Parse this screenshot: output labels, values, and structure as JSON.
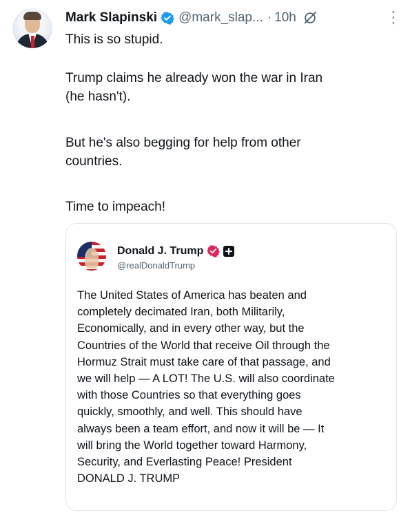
{
  "post": {
    "author_name": "Mark Slapinski",
    "author_handle": "@mark_slap...",
    "separator": "·",
    "time": "10h",
    "icons": {
      "verified": "verified-badge-icon",
      "grok": "grok-icon",
      "more": "more-options-icon"
    },
    "more_glyph": "⋮",
    "paragraphs": [
      "This is so stupid.",
      "Trump claims he already won the war in Iran\n(he hasn't).",
      "But he's also begging for help from other\ncountries.",
      "Time to impeach!"
    ]
  },
  "quoted_post": {
    "author_name": "Donald J. Trump",
    "author_handle": "@realDonaldTrump",
    "icons": {
      "verified": "verified-badge-icon",
      "affiliate": "plus-badge-icon"
    },
    "text": "The United States of America has beaten and\ncompletely decimated Iran, both Militarily,\nEconomically, and in every other way, but the\nCountries of the World that receive Oil through the\nHormuz Strait must take care of that passage, and\nwe will help — A LOT! The U.S. will also coordinate\nwith those Countries so that everything goes\nquickly, smoothly, and well. This should have\nalways been a team effort, and now it will be — It\nwill bring the World together toward Harmony,\nSecurity, and Everlasting Peace! President\nDONALD J. TRUMP"
  },
  "colors": {
    "text": "#0f1419",
    "secondary": "#536471",
    "verified_blue": "#1d9bf0",
    "verified_pink": "#e0245e",
    "border": "#e1e6ea"
  }
}
